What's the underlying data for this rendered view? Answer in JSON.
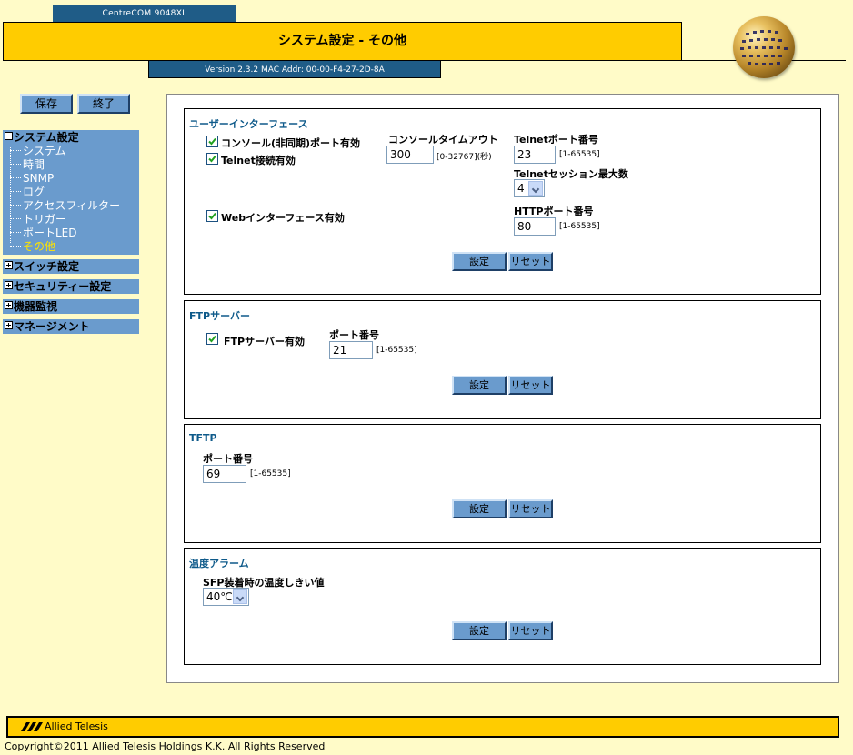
{
  "header": {
    "model": "CentreCOM 9048XL",
    "title": "システム設定 - その他",
    "version": "Version 2.3.2 MAC Addr: 00-00-F4-27-2D-8A"
  },
  "top_buttons": {
    "save": "保存",
    "exit": "終了"
  },
  "sidebar": {
    "groups": [
      {
        "label": "システム設定",
        "expanded": true,
        "items": [
          "システム",
          "時間",
          "SNMP",
          "ログ",
          "アクセスフィルター",
          "トリガー",
          "ポートLED",
          "その他"
        ],
        "active_item": "その他"
      },
      {
        "label": "スイッチ設定",
        "expanded": false
      },
      {
        "label": "セキュリティー設定",
        "expanded": false
      },
      {
        "label": "機器監視",
        "expanded": false
      },
      {
        "label": "マネージメント",
        "expanded": false
      }
    ]
  },
  "ui_section": {
    "title": "ユーザーインターフェース",
    "console_enabled": {
      "label": "コンソール(非同期)ポート有効",
      "checked": true
    },
    "telnet_enabled": {
      "label": "Telnet接続有効",
      "checked": true
    },
    "web_enabled": {
      "label": "Webインターフェース有効",
      "checked": true
    },
    "console_timeout": {
      "label": "コンソールタイムアウト",
      "value": "300",
      "hint": "[0-32767](秒)"
    },
    "telnet_port": {
      "label": "Telnetポート番号",
      "value": "23",
      "hint": "[1-65535]"
    },
    "telnet_sessions": {
      "label": "Telnetセッション最大数",
      "value": "4"
    },
    "http_port": {
      "label": "HTTPポート番号",
      "value": "80",
      "hint": "[1-65535]"
    }
  },
  "ftp_section": {
    "title": "FTPサーバー",
    "ftp_enabled": {
      "label": "FTPサーバー有効",
      "checked": true
    },
    "port": {
      "label": "ポート番号",
      "value": "21",
      "hint": "[1-65535]"
    }
  },
  "tftp_section": {
    "title": "TFTP",
    "port": {
      "label": "ポート番号",
      "value": "69",
      "hint": "[1-65535]"
    }
  },
  "temp_section": {
    "title": "温度アラーム",
    "threshold": {
      "label": "SFP装着時の温度しきい値",
      "value": "40℃"
    }
  },
  "buttons": {
    "set": "設定",
    "reset": "リセット"
  },
  "footer": {
    "brand": "Allied Telesis",
    "copyright": "Copyright©2011 Allied Telesis Holdings K.K. All Rights Reserved"
  },
  "colors": {
    "header_yellow": "#FFCC00",
    "nav_blue": "#6A9BCD",
    "dark_blue": "#1F5C87",
    "background": "#FFFBC8",
    "active_menu": "#FFE400"
  },
  "icons": [
    "globe-logo",
    "checkbox-checked-icon",
    "dropdown-arrow-icon",
    "expand-plus-icon",
    "collapse-minus-icon",
    "allied-telesis-logo"
  ]
}
